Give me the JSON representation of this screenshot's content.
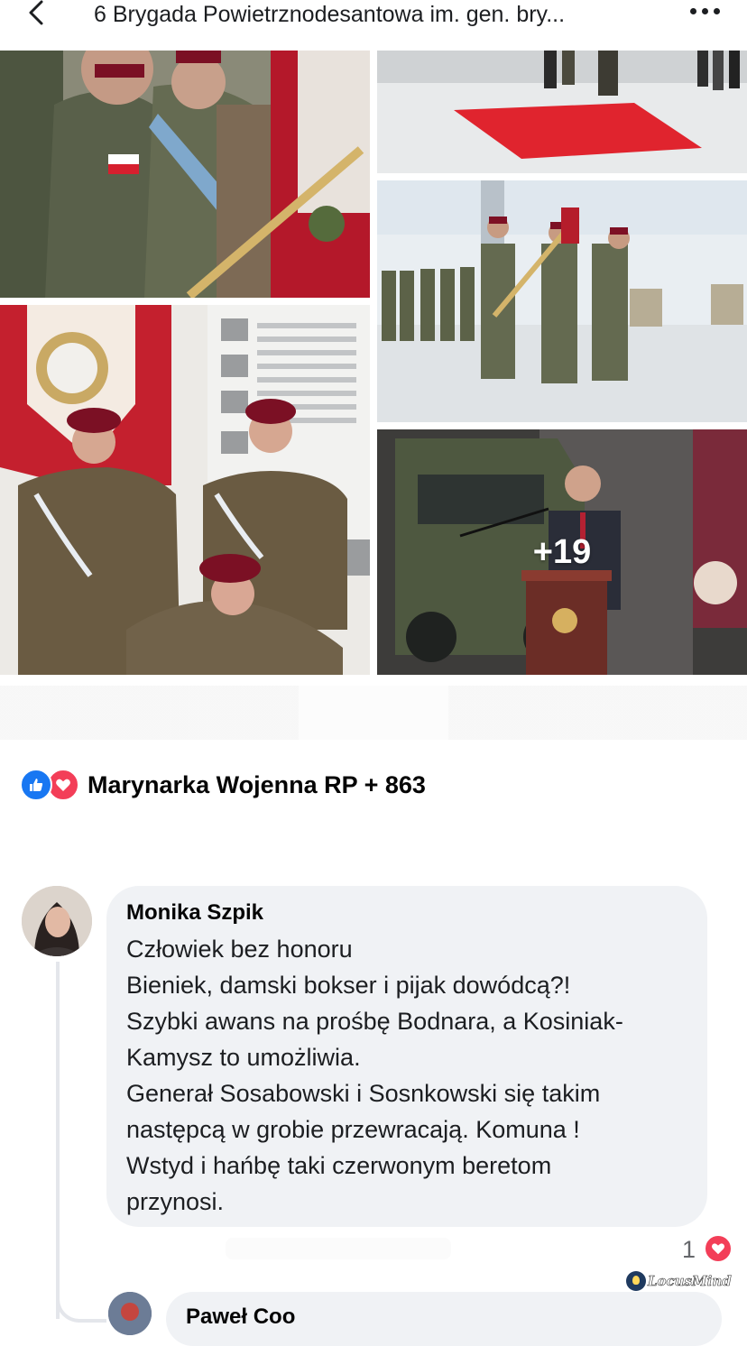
{
  "header": {
    "title": "6 Brygada Powietrznodesantowa im. gen. bry...",
    "back_icon": "chevron-left-icon",
    "more_icon": "more-horizontal-icon"
  },
  "photos": {
    "more_count": "+19"
  },
  "reactions": {
    "icons": [
      "like-icon",
      "love-icon"
    ],
    "summary": "Marynarka Wojenna RP + 863"
  },
  "comment": {
    "author": "Monika Szpik",
    "text": "Człowiek  bez honoru\nBieniek, damski bokser i pijak dowódcą?!\nSzybki awans na prośbę Bodnara, a Kosiniak-\nKamysz to umożliwia.\nGenerał Sosabowski i Sosnkowski się takim\nnastępcą w grobie przewracają. Komuna !\nWstyd i hańbę taki czerwonym beretom\nprzynosi.",
    "reaction_count": "1"
  },
  "reply": {
    "author": "Paweł Coo"
  },
  "watermark": "LocusMind",
  "colors": {
    "like_blue": "#1877f2",
    "love_red": "#f33e58",
    "bubble_bg": "#f0f2f5"
  }
}
